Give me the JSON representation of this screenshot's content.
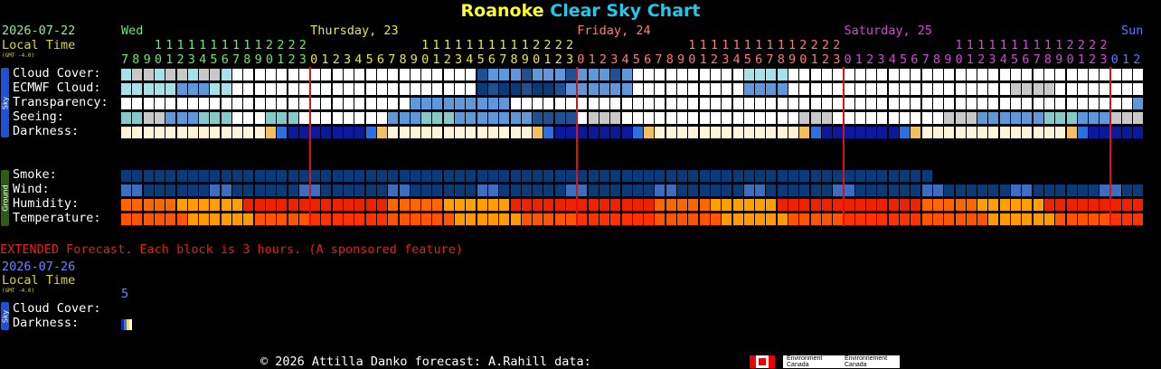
{
  "title": {
    "location": "Roanoke",
    "rest": "Clear Sky Chart"
  },
  "header": {
    "date": "2026-07-22",
    "local_time": "Local Time",
    "gmt": "(GMT -4.0)",
    "days": [
      {
        "label": "Wed",
        "color": "#6ce86c"
      },
      {
        "label": "Thursday, 23",
        "color": "#e6e64c"
      },
      {
        "label": "Friday, 24",
        "color": "#ff7a7a"
      },
      {
        "label": "Saturday, 25",
        "color": "#d24ad2"
      },
      {
        "label": "Sun",
        "color": "#5a78ff"
      }
    ],
    "hours": [
      7,
      8,
      9,
      10,
      11,
      12,
      13,
      14,
      15,
      16,
      17,
      18,
      19,
      20,
      21,
      22,
      23,
      0,
      1,
      2,
      3,
      4,
      5,
      6,
      7,
      8,
      9,
      10,
      11,
      12,
      13,
      14,
      15,
      16,
      17,
      18,
      19,
      20,
      21,
      22,
      23,
      0,
      1,
      2,
      3,
      4,
      5,
      6,
      7,
      8,
      9,
      10,
      11,
      12,
      13,
      14,
      15,
      16,
      17,
      18,
      19,
      20,
      21,
      22,
      23,
      0,
      1,
      2,
      3,
      4,
      5,
      6,
      7,
      8,
      9,
      10,
      11,
      12,
      13,
      14,
      15,
      16,
      17,
      18,
      19,
      20,
      21,
      22,
      23,
      0,
      1,
      2
    ]
  },
  "sections": {
    "sky": "Sky",
    "ground": "Ground"
  },
  "rows": [
    {
      "label": "Cloud Cover:",
      "group": "sky"
    },
    {
      "label": "ECMWF Cloud:",
      "group": "sky"
    },
    {
      "label": "Transparency:",
      "group": "sky"
    },
    {
      "label": "Seeing:",
      "group": "sky"
    },
    {
      "label": "Darkness:",
      "group": "sky"
    },
    {
      "label": "Smoke:",
      "group": "ground"
    },
    {
      "label": "Wind:",
      "group": "ground"
    },
    {
      "label": "Humidity:",
      "group": "ground"
    },
    {
      "label": "Temperature:",
      "group": "ground"
    }
  ],
  "extended": {
    "notice": "EXTENDED Forecast. Each block is 3 hours. (A sponsored feature)",
    "date": "2026-07-26",
    "local_time": "Local Time",
    "gmt": "(GMT -4.0)",
    "hour": "5",
    "rows": [
      "Cloud Cover:",
      "Darkness:"
    ],
    "section": "Sky"
  },
  "footer": {
    "text": "© 2026 Attilla Danko  forecast: A.Rahill  data:",
    "logo_en": "Environment Canada",
    "logo_fr": "Environnement Canada"
  },
  "colors": {
    "day_line": "#dd1111",
    "sky_tab": "#1e50d8",
    "ground_tab": "#2f5b14"
  }
}
